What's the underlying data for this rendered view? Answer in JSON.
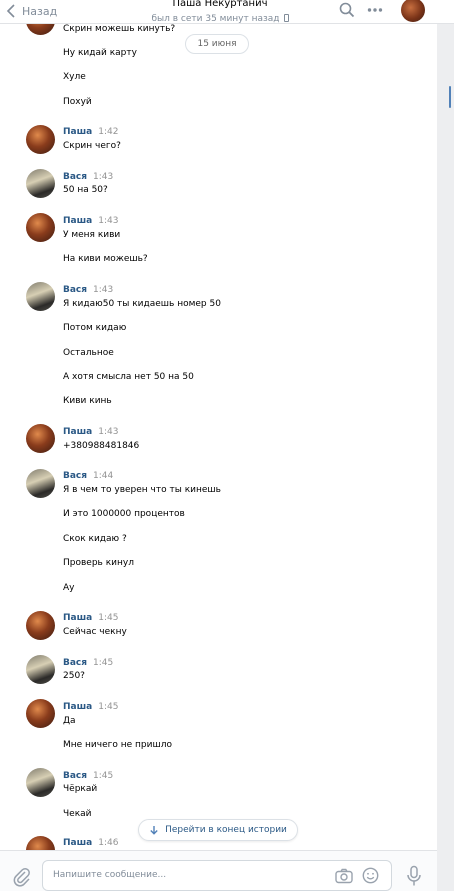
{
  "header": {
    "back_label": "Назад",
    "peer_name": "Паша Некуртанич",
    "peer_status": "был в сети 35 минут назад"
  },
  "date_divider": "15 июня",
  "messages": [
    {
      "lines": [
        "Скрин можешь кинуть?",
        "Ну кидай карту",
        "Хуле",
        "Похуй"
      ]
    },
    {
      "author": "Паша",
      "time": "1:42",
      "lines": [
        "Скрин чего?"
      ]
    },
    {
      "author": "Вася",
      "time": "1:43",
      "lines": [
        "50 на 50?"
      ]
    },
    {
      "author": "Паша",
      "time": "1:43",
      "lines": [
        "У меня киви",
        "На киви можешь?"
      ]
    },
    {
      "author": "Вася",
      "time": "1:43",
      "lines": [
        "Я кидаю50 ты кидаешь номер 50",
        "Потом кидаю",
        "Остальное",
        "А хотя смысла нет 50 на 50",
        "Киви кинь"
      ]
    },
    {
      "author": "Паша",
      "time": "1:43",
      "lines": [
        "+380988481846"
      ]
    },
    {
      "author": "Вася",
      "time": "1:44",
      "lines": [
        "Я в чем то уверен что ты кинешь",
        "И это 1000000 процентов",
        "Скок кидаю ?",
        "Проверь кинул",
        "Ау"
      ]
    },
    {
      "author": "Паша",
      "time": "1:45",
      "lines": [
        "Сейчас чекну"
      ]
    },
    {
      "author": "Вася",
      "time": "1:45",
      "lines": [
        "250?"
      ]
    },
    {
      "author": "Паша",
      "time": "1:45",
      "lines": [
        "Да",
        "Мне ничего не пришло"
      ]
    },
    {
      "author": "Вася",
      "time": "1:45",
      "lines": [
        "Чёркай",
        "Чекай"
      ]
    },
    {
      "author": "Паша",
      "time": "1:46",
      "lines": []
    }
  ],
  "scroll_to_end_label": "Перейти в конец истории",
  "composer": {
    "placeholder": "Напишите сообщение..."
  }
}
